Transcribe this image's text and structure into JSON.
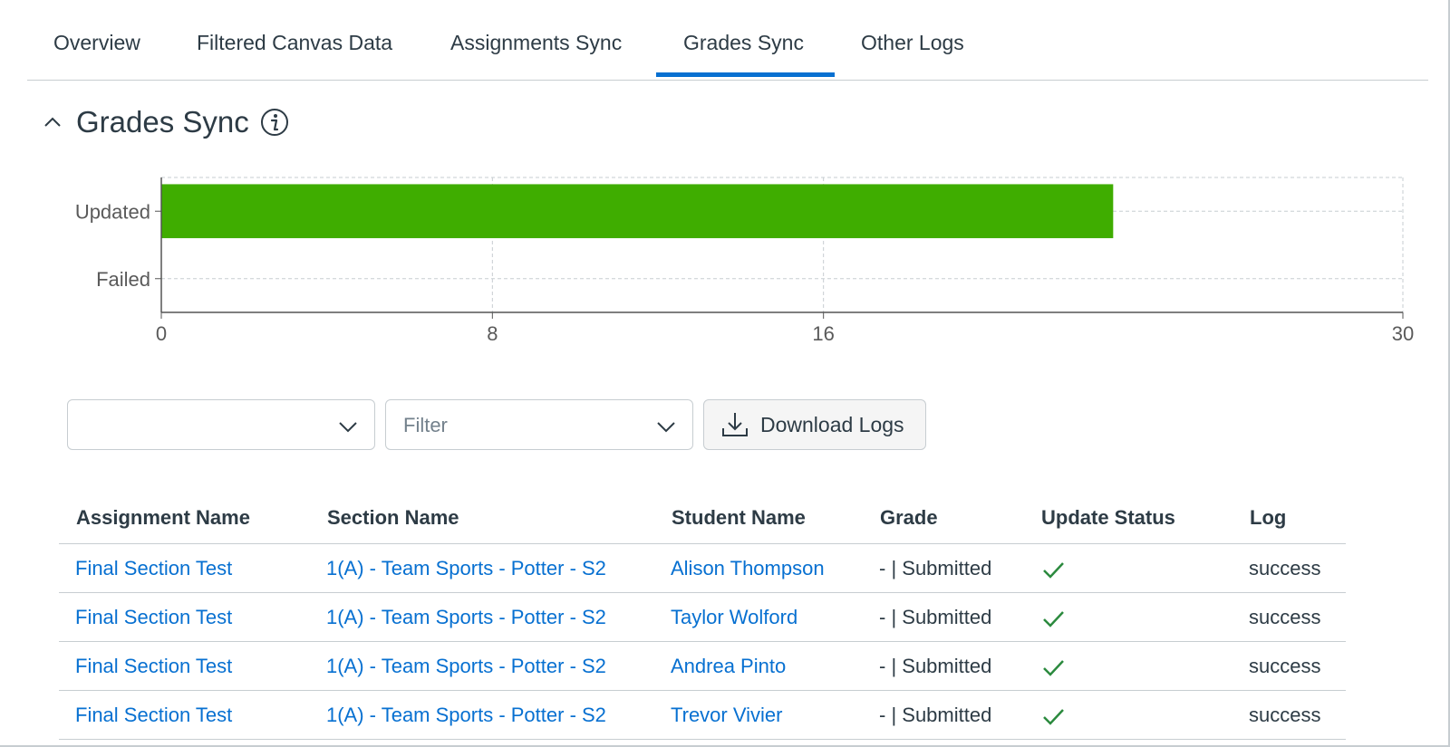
{
  "tabs": [
    {
      "label": "Overview",
      "active": false
    },
    {
      "label": "Filtered Canvas Data",
      "active": false
    },
    {
      "label": "Assignments Sync",
      "active": false
    },
    {
      "label": "Grades Sync",
      "active": true
    },
    {
      "label": "Other Logs",
      "active": false
    }
  ],
  "section": {
    "title": "Grades Sync",
    "collapse_icon": "chevron-up-icon",
    "info_icon": "info-icon"
  },
  "chart_data": {
    "type": "bar",
    "orientation": "horizontal",
    "categories": [
      "Updated",
      "Failed"
    ],
    "values": [
      23,
      0
    ],
    "xlim": [
      0,
      30
    ],
    "xticks": [
      0,
      8,
      16,
      30
    ],
    "grid": true,
    "colors": {
      "bar": "#3fad00",
      "grid": "#c7cdd1",
      "axis": "#555555"
    }
  },
  "controls": {
    "select1": {
      "value": "",
      "icon": "chevron-down-icon"
    },
    "filter": {
      "placeholder": "Filter",
      "icon": "chevron-down-icon"
    },
    "download": {
      "label": "Download Logs",
      "icon": "download-icon"
    }
  },
  "table": {
    "headers": [
      "Assignment Name",
      "Section Name",
      "Student Name",
      "Grade",
      "Update Status",
      "Log"
    ],
    "rows": [
      {
        "assignment": "Final Section Test",
        "section": "1(A) - Team Sports - Potter - S2",
        "student": "Alison Thompson",
        "grade": "- | Submitted",
        "status": "check-icon",
        "log": "success"
      },
      {
        "assignment": "Final Section Test",
        "section": "1(A) - Team Sports - Potter - S2",
        "student": "Taylor Wolford",
        "grade": "- | Submitted",
        "status": "check-icon",
        "log": "success"
      },
      {
        "assignment": "Final Section Test",
        "section": "1(A) - Team Sports - Potter - S2",
        "student": "Andrea Pinto",
        "grade": "- | Submitted",
        "status": "check-icon",
        "log": "success"
      },
      {
        "assignment": "Final Section Test",
        "section": "1(A) - Team Sports - Potter - S2",
        "student": "Trevor Vivier",
        "grade": "- | Submitted",
        "status": "check-icon",
        "log": "success"
      }
    ]
  },
  "colors": {
    "accent": "#0770d1",
    "success": "#2b8a3e",
    "text": "#2d3b45",
    "border": "#c7cdd1"
  }
}
